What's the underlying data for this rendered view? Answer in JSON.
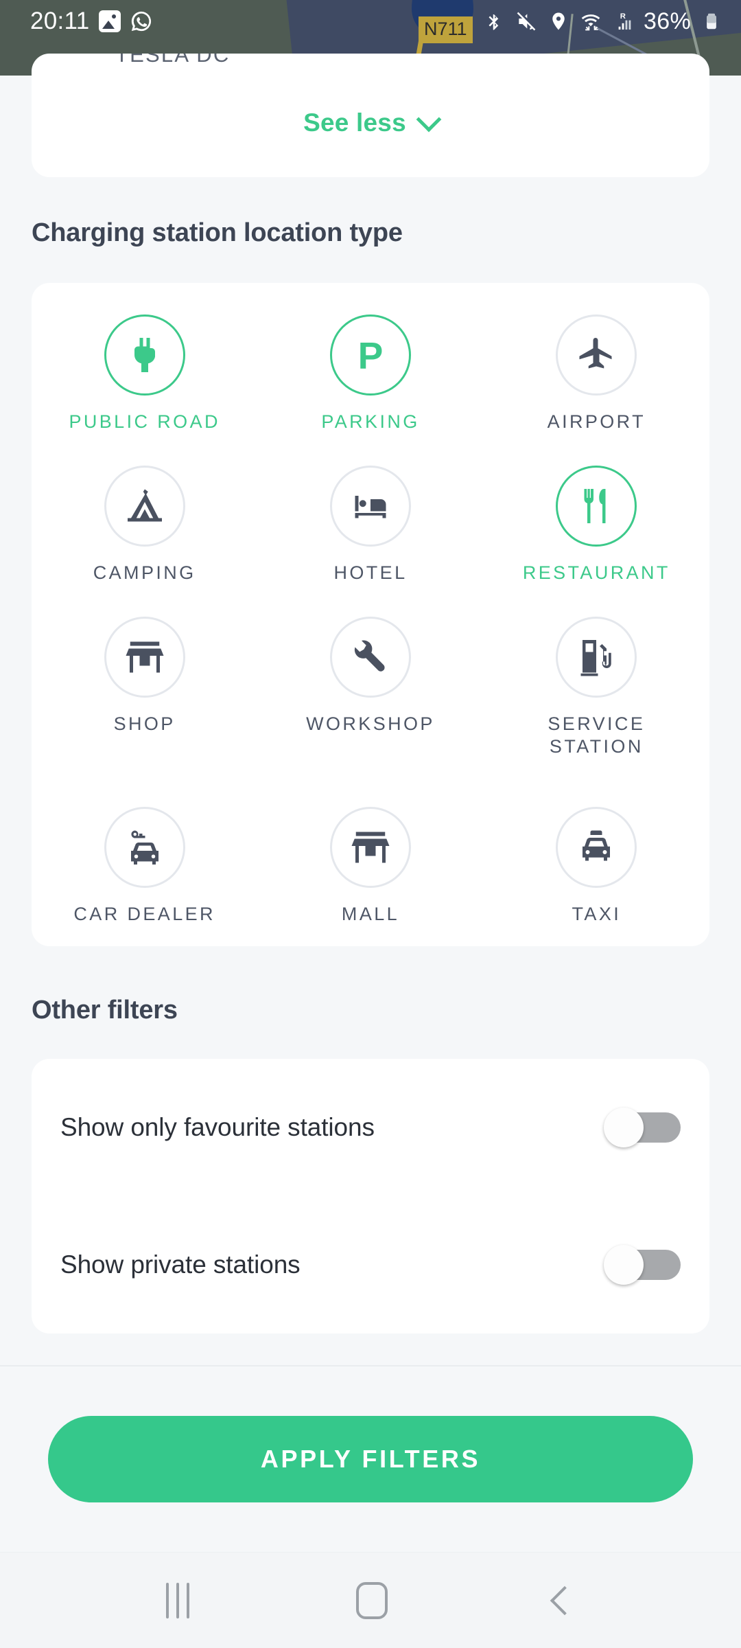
{
  "status_bar": {
    "time": "20:11",
    "battery_percent": "36%",
    "left_icons": [
      "photo-icon",
      "whatsapp-icon"
    ],
    "right_icons": [
      "bluetooth-icon",
      "mute-icon",
      "location-pin-icon",
      "wifi-icon",
      "signal-roaming-icon",
      "battery-icon"
    ],
    "map_road_label": "N711"
  },
  "top_card": {
    "clipped_title": "TESLA DC",
    "see_less_label": "See less"
  },
  "location_section": {
    "title": "Charging station location type",
    "items": [
      {
        "label": "PUBLIC ROAD",
        "icon": "plug-icon",
        "selected": true
      },
      {
        "label": "PARKING",
        "icon": "parking-p-icon",
        "selected": true
      },
      {
        "label": "AIRPORT",
        "icon": "airplane-icon",
        "selected": false
      },
      {
        "label": "CAMPING",
        "icon": "tent-icon",
        "selected": false
      },
      {
        "label": "HOTEL",
        "icon": "bed-icon",
        "selected": false
      },
      {
        "label": "RESTAURANT",
        "icon": "fork-knife-icon",
        "selected": true
      },
      {
        "label": "SHOP",
        "icon": "storefront-icon",
        "selected": false
      },
      {
        "label": "WORKSHOP",
        "icon": "wrench-icon",
        "selected": false
      },
      {
        "label": "SERVICE STATION",
        "icon": "fuel-pump-icon",
        "selected": false
      },
      {
        "label": "CAR DEALER",
        "icon": "car-key-icon",
        "selected": false
      },
      {
        "label": "MALL",
        "icon": "storefront-icon",
        "selected": false
      },
      {
        "label": "TAXI",
        "icon": "taxi-icon",
        "selected": false
      }
    ]
  },
  "other_filters": {
    "title": "Other filters",
    "rows": [
      {
        "label": "Show only favourite stations",
        "value": "off"
      },
      {
        "label": "Show private stations",
        "value": "off"
      }
    ]
  },
  "footer": {
    "apply_label": "APPLY FILTERS"
  },
  "navigation_bar": {
    "recents_label": "recents-icon",
    "home_label": "home-icon",
    "back_label": "back-icon"
  },
  "colors": {
    "accent_green": "#35C88B",
    "selected_green": "#3CC98A",
    "icon_dark": "#4A5160",
    "heading": "#3D4554",
    "page_bg": "#F5F7F9",
    "card_bg": "#FFFFFF",
    "circle_border": "#E4E7EC",
    "switch_track_off": "#A7A9AC"
  }
}
